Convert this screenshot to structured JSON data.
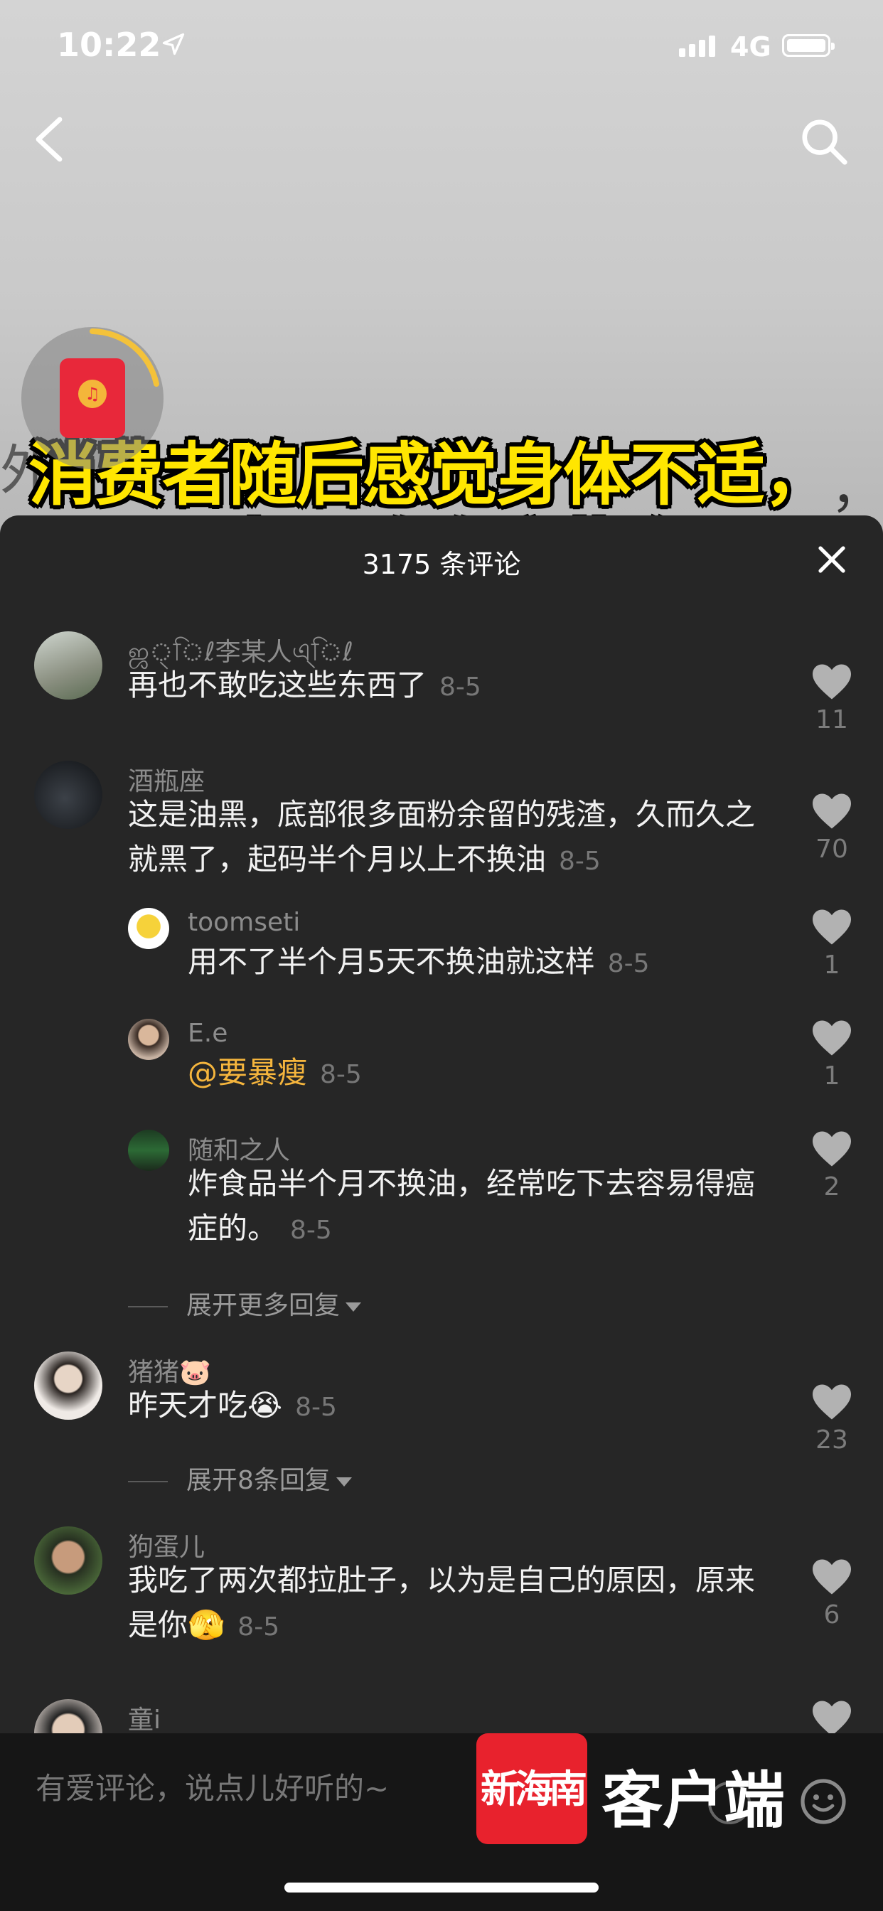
{
  "status_bar": {
    "time": "10:22",
    "network": "4G"
  },
  "video": {
    "caption": "消费者随后感觉身体不适，",
    "caption_next_line": "再也不敢吃这些东西了",
    "bg_text_left": "外",
    "bg_text_right": "，",
    "redpacket_coin": "♫"
  },
  "panel": {
    "comment_count": "3175 条评论"
  },
  "comments": [
    {
      "username": "ஜ্িℓ李某人এ্িℓ",
      "text": "再也不敢吃这些东西了",
      "date": "8-5",
      "likes": "11"
    },
    {
      "username": "酒瓶座",
      "text": "这是油黑，底部很多面粉余留的残渣，久而久之就黑了，起码半个月以上不换油",
      "date": "8-5",
      "likes": "70"
    },
    {
      "username": "toomseti",
      "text": "用不了半个月5天不换油就这样",
      "date": "8-5",
      "likes": "1"
    },
    {
      "username": "E.e",
      "mention": "@要暴瘦",
      "date": "8-5",
      "likes": "1"
    },
    {
      "username": "随和之人",
      "text": "炸食品半个月不换油，经常吃下去容易得癌症的。",
      "date": "8-5",
      "likes": "2"
    },
    {
      "username": "猪猪🐷",
      "text": "昨天才吃😭",
      "date": "8-5",
      "likes": "23"
    },
    {
      "username": "狗蛋儿",
      "text": "我吃了两次都拉肚子，以为是自己的原因，原来是你🫣",
      "date": "8-5",
      "likes": "6"
    },
    {
      "username": "童i"
    }
  ],
  "expand_more_replies": "展开更多回复",
  "expand_8_replies": "展开8条回复",
  "input": {
    "placeholder": "有爱评论，说点儿好听的~"
  },
  "watermark": {
    "logo": "新海南",
    "text": "客户端"
  },
  "colors": {
    "panel_bg": "#262626",
    "accent_mention": "#f5b53d",
    "caption_yellow": "#ffe600",
    "logo_red": "#e8222d"
  },
  "icons": [
    "location-arrow-icon",
    "signal-icon",
    "battery-icon",
    "back-chevron-icon",
    "search-icon",
    "red-packet-icon",
    "close-icon",
    "heart-icon",
    "caret-down-icon",
    "at-icon",
    "emoji-icon"
  ]
}
